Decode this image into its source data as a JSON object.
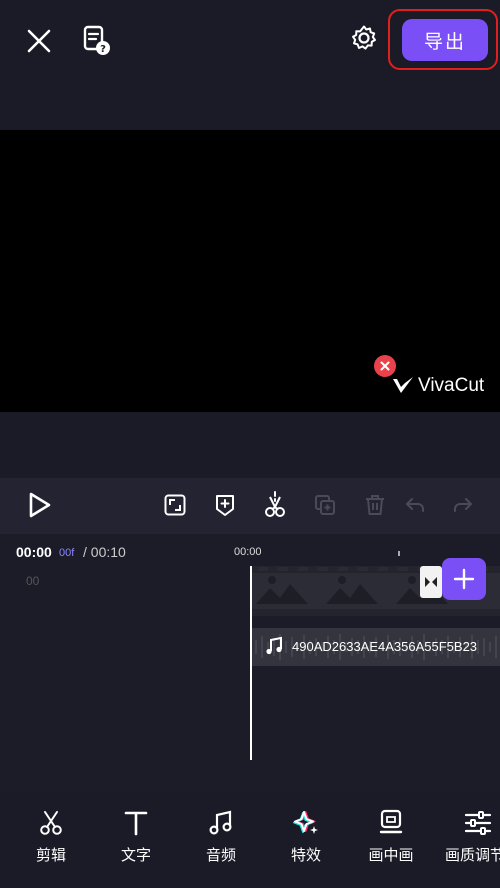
{
  "header": {
    "export_label": "导出"
  },
  "preview": {
    "watermark_text": "VivaCut"
  },
  "timeline": {
    "current_time": "00:00",
    "current_frame": "00f",
    "total_time": "/ 00:10",
    "ruler_start": "00:00",
    "track_label": "00",
    "audio_clip_name": "490AD2633AE4A356A55F5B23"
  },
  "toolbar": {
    "items": [
      {
        "label": "剪辑",
        "icon": "scissors-icon"
      },
      {
        "label": "文字",
        "icon": "text-icon"
      },
      {
        "label": "音频",
        "icon": "music-icon"
      },
      {
        "label": "特效",
        "icon": "effects-sparkle-icon"
      },
      {
        "label": "画中画",
        "icon": "pip-icon"
      },
      {
        "label": "画质调节",
        "icon": "adjust-sliders-icon"
      }
    ]
  },
  "colors": {
    "accent": "#7a4ff5",
    "highlight_border": "#e0201d",
    "background": "#1b1a27"
  }
}
